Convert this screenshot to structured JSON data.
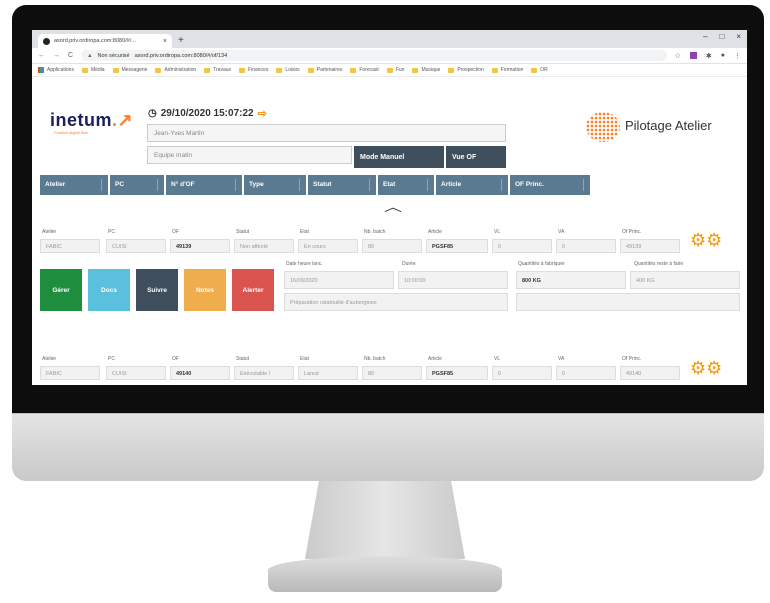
{
  "browser": {
    "tab_title": "asord.priv.ordiropa.com:8080/#/...",
    "tab_close": "×",
    "new_tab": "+",
    "win_min": "–",
    "win_max": "□",
    "win_close": "×",
    "nav_back": "←",
    "nav_forward": "→",
    "nav_reload": "C",
    "security_label": "Non sécurisé",
    "url": "asord.priv.ordiropa.com:8080/#/of/134",
    "bookmarks": [
      "Applications",
      "Média",
      "Messagerie",
      "Administration",
      "Travaux",
      "Finances",
      "Loisirs",
      "Partenaires",
      "Forecast",
      "Fun",
      "Musique",
      "Prospection",
      "Formation",
      "OR"
    ]
  },
  "header": {
    "logo_text": "inetum",
    "logo_tagline": "Positive digital flow",
    "datetime": "29/10/2020 15:07:22",
    "user": "Jean-Yves Martin",
    "team": "Equipe matin",
    "mode_button": "Mode Manuel",
    "view_button": "Vue OF",
    "app_title": "Pilotage Atelier"
  },
  "filters": [
    "Atelier",
    "PC",
    "N° d'OF",
    "Type",
    "Statut",
    "Etat",
    "Article",
    "OF Princ."
  ],
  "record_labels": {
    "atelier": "Atelier",
    "pc": "PC",
    "of": "OF",
    "statut": "Statut",
    "etat": "Etat",
    "nb_batch": "Nb. batch",
    "article": "Article",
    "vl": "VL",
    "va": "VA",
    "of_princ": "Of Princ.",
    "date_lanc": "Date heure lanc.",
    "duree": "Durée",
    "qte_fab": "Quantités à fabriquer",
    "qte_reste": "Quantités reste à faire"
  },
  "records": [
    {
      "atelier": "FABIC",
      "pc": "CUISI",
      "of": "49139",
      "statut": "Non affecté",
      "etat": "En cours",
      "nb_batch": "80",
      "article": "PGSF85",
      "vl": "0",
      "va": "0",
      "of_princ": "49139",
      "date_lanc": "16/09/2020",
      "duree": "10:00:00",
      "qte_fab": "800 KG",
      "qte_reste": "400 KG",
      "description": "Préparation ratatouille d'aubergines"
    },
    {
      "atelier": "FABIC",
      "pc": "CUISI",
      "of": "49140",
      "statut": "Exécutable l",
      "etat": "Lancé",
      "nb_batch": "80",
      "article": "PGSF85",
      "vl": "0",
      "va": "0",
      "of_princ": "49140"
    }
  ],
  "actions": [
    {
      "label": "Gérer",
      "color": "#1e8e3e"
    },
    {
      "label": "Docs",
      "color": "#5bc0de"
    },
    {
      "label": "Suivre",
      "color": "#3f4e5c"
    },
    {
      "label": "Notes",
      "color": "#f0ad4e"
    },
    {
      "label": "Alerter",
      "color": "#d9534f"
    }
  ]
}
